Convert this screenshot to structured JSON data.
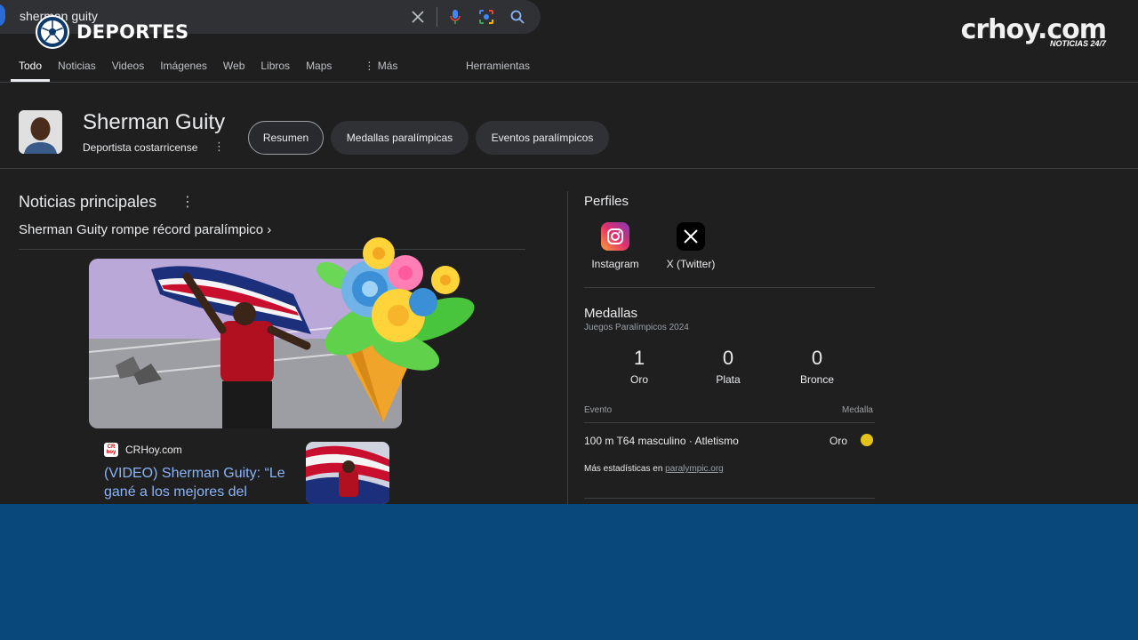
{
  "search": {
    "query": "sherman guity"
  },
  "brand": {
    "section": "DEPORTES",
    "logo": "crhoy.com",
    "tagline": "NOTICIAS 24/7"
  },
  "tabs": [
    "Todo",
    "Noticias",
    "Videos",
    "Imágenes",
    "Web",
    "Libros",
    "Maps",
    "⋮ Más"
  ],
  "tools_label": "Herramientas",
  "entity": {
    "name": "Sherman Guity",
    "subtitle": "Deportista costarricense",
    "chips": [
      "Resumen",
      "Medallas paralímpicas",
      "Eventos paralímpicos"
    ]
  },
  "news": {
    "title": "Noticias principales",
    "top_link": "Sherman Guity rompe récord paralímpico",
    "source": "CRHoy.com",
    "headline": "(VIDEO) Sherman Guity: “Le gané a los mejores del"
  },
  "profiles": {
    "title": "Perfiles",
    "items": [
      {
        "label": "Instagram",
        "icon": "instagram-icon"
      },
      {
        "label": "X (Twitter)",
        "icon": "x-twitter-icon"
      }
    ]
  },
  "medals": {
    "title": "Medallas",
    "subtitle": "Juegos Paralímpicos 2024",
    "counts": [
      {
        "label": "Oro",
        "value": "1"
      },
      {
        "label": "Plata",
        "value": "0"
      },
      {
        "label": "Bronce",
        "value": "0"
      }
    ],
    "table_header": {
      "event": "Evento",
      "medal": "Medalla"
    },
    "events": [
      {
        "name": "100 m T64 masculino · Atletismo",
        "medal": "Oro"
      }
    ],
    "more_prefix": "Más estadísticas en",
    "more_link": "paralympic.org"
  },
  "colors": {
    "link": "#8ab4f8",
    "gold": "#e4c21a",
    "band": "#09487a"
  }
}
